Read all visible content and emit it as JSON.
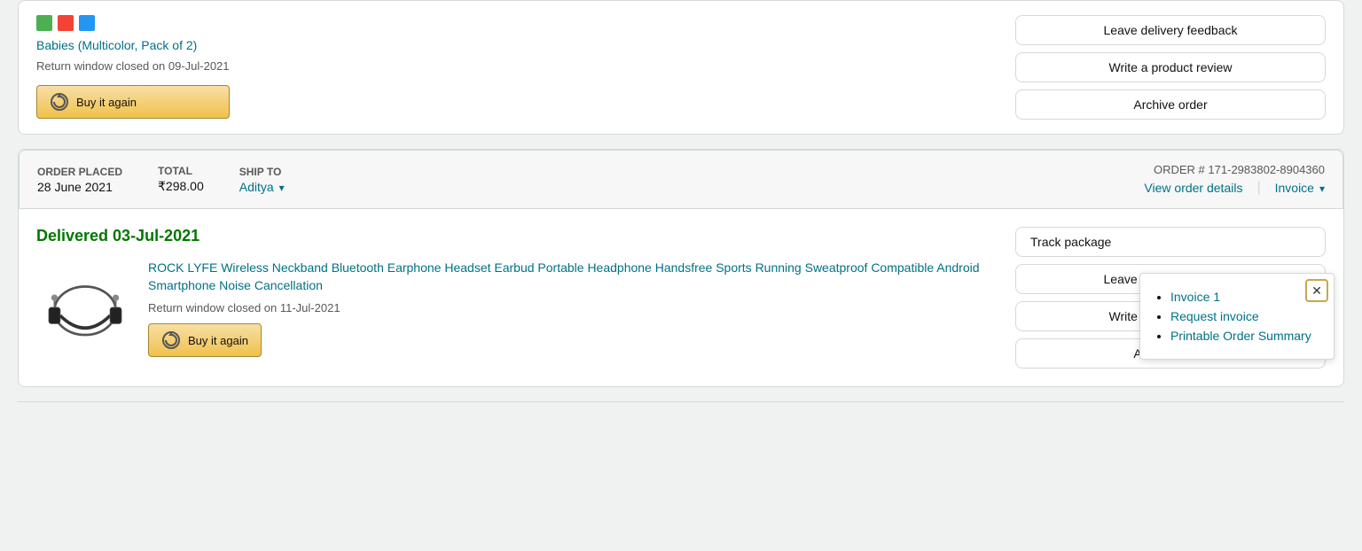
{
  "page": {
    "background": "#f0f2f2"
  },
  "topCard": {
    "productName": "Babies (Multicolor, Pack of 2)",
    "returnWindow": "Return window closed on 09-Jul-2021",
    "buyAgainLabel": "Buy it again",
    "actions": [
      {
        "id": "leave-delivery-feedback-top",
        "label": "Leave delivery feedback"
      },
      {
        "id": "write-review-top",
        "label": "Write a product review"
      },
      {
        "id": "archive-order-top",
        "label": "Archive order"
      }
    ]
  },
  "order2": {
    "header": {
      "orderPlacedLabel": "ORDER PLACED",
      "orderPlacedValue": "28 June 2021",
      "totalLabel": "TOTAL",
      "totalValue": "₹298.00",
      "shipToLabel": "SHIP TO",
      "shipToValue": "Aditya",
      "orderNumberLabel": "ORDER #",
      "orderNumberValue": "171-2983802-8904360",
      "viewOrderDetails": "View order details",
      "invoice": "Invoice"
    },
    "deliveryStatus": "Delivered 03-Jul-2021",
    "product": {
      "name": "ROCK LYFE Wireless Neckband Bluetooth Earphone Headset Earbud Portable Headphone Handsfree Sports Running Sweatproof Compatible Android Smartphone Noise Cancellation",
      "returnWindow": "Return window closed on 11-Jul-2021",
      "buyAgainLabel": "Buy it again"
    },
    "actions": [
      {
        "id": "track-package",
        "label": "Tr..."
      },
      {
        "id": "leave-delivery-feedback",
        "label": "Leave delivery feedback"
      },
      {
        "id": "write-product-review",
        "label": "Write a product review"
      },
      {
        "id": "archive-order",
        "label": "Archive order"
      }
    ],
    "invoicePopup": {
      "items": [
        {
          "id": "invoice-1",
          "label": "Invoice 1"
        },
        {
          "id": "request-invoice",
          "label": "Request invoice"
        },
        {
          "id": "printable-order-summary",
          "label": "Printable Order Summary"
        }
      ]
    }
  }
}
